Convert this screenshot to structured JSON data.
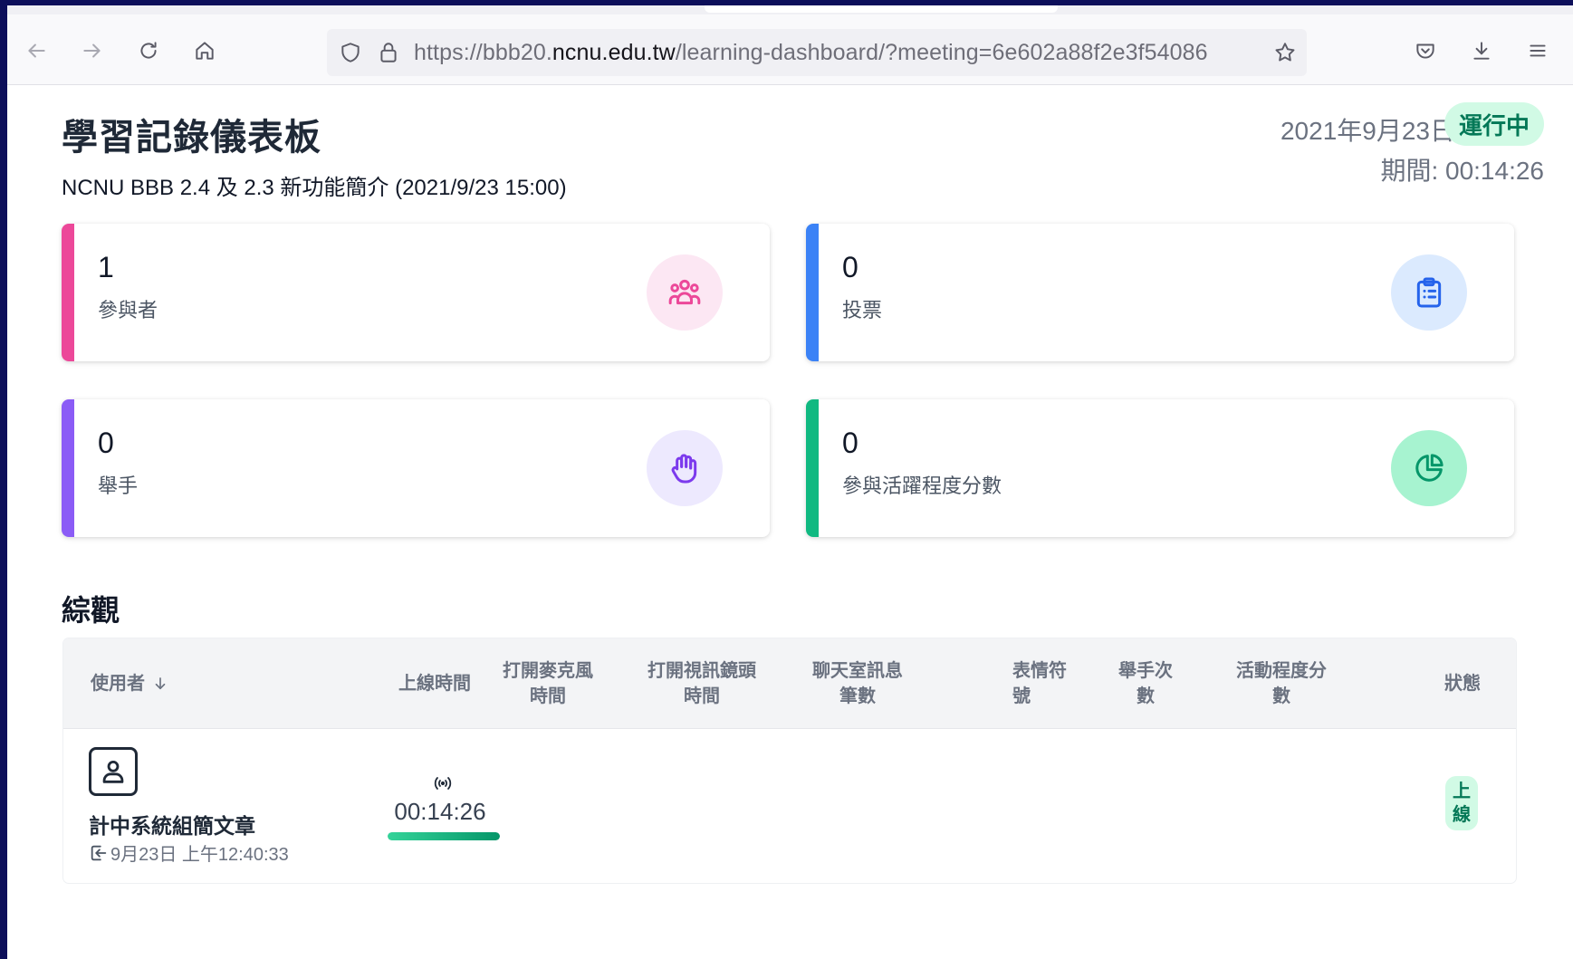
{
  "browser": {
    "url_prefix": "https://bbb20.",
    "url_domain": "ncnu.edu.tw",
    "url_path": "/learning-dashboard/?meeting=6e602a88f2e3f54086"
  },
  "header": {
    "title": "學習記錄儀表板",
    "meeting_name": "NCNU BBB 2.4 及 2.3 新功能簡介 (2021/9/23 15:00)",
    "date": "2021年9月23日",
    "status": "運行中",
    "duration": "期間: 00:14:26"
  },
  "cards": [
    {
      "value": "1",
      "label": "參與者",
      "accent": "#ec4899",
      "icon_bg": "#fce7f3",
      "icon_color": "#ec4899",
      "icon": "users-icon"
    },
    {
      "value": "0",
      "label": "投票",
      "accent": "#3b82f6",
      "icon_bg": "#dbeafe",
      "icon_color": "#2563eb",
      "icon": "clipboard-icon"
    },
    {
      "value": "0",
      "label": "舉手",
      "accent": "#8b5cf6",
      "icon_bg": "#ede9fe",
      "icon_color": "#7c3aed",
      "icon": "hand-icon"
    },
    {
      "value": "0",
      "label": "參與活躍程度分數",
      "accent": "#10b981",
      "icon_bg": "#a7f3d0",
      "icon_color": "#059669",
      "icon": "pie-chart-icon"
    }
  ],
  "overview": {
    "title": "綜觀",
    "columns": {
      "user": "使用者",
      "online_time": "上線時間",
      "mic_time": [
        "打開麥克風",
        "時間"
      ],
      "webcam_time": [
        "打開視訊鏡頭",
        "時間"
      ],
      "chat_count": [
        "聊天室訊息",
        "筆數"
      ],
      "emoji": [
        "表情符",
        "號"
      ],
      "raise_hand": [
        "舉手次",
        "數"
      ],
      "activity": [
        "活動程度分",
        "數"
      ],
      "status": "狀態"
    },
    "rows": [
      {
        "name": "計中系統組簡文章",
        "joined": "9月23日 上午12:40:33",
        "online_time": "00:14:26",
        "online_progress": 1.0,
        "status": "上線"
      }
    ]
  }
}
